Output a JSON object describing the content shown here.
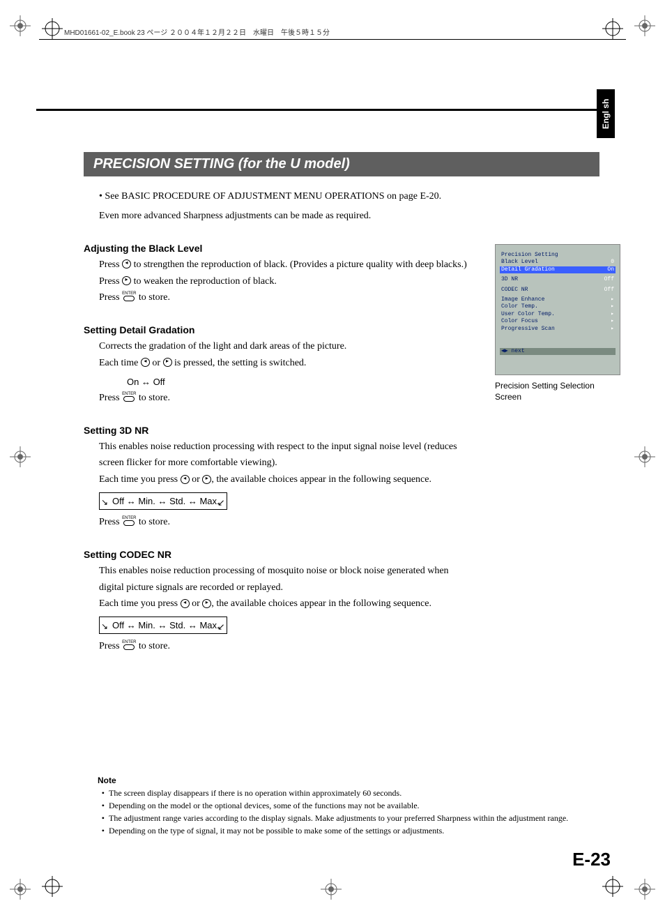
{
  "meta": {
    "header_line": "MHD01661-02_E.book  23 ページ  ２００４年１２月２２日　水曜日　午後５時１５分"
  },
  "lang_tab": "English",
  "title": "PRECISION SETTING (for the U model)",
  "intro": {
    "bullet": "See BASIC PROCEDURE OF ADJUSTMENT MENU OPERATIONS on page E-20.",
    "line": "Even more advanced Sharpness adjustments can be made as required."
  },
  "black_level": {
    "head": "Adjusting the Black Level",
    "l1a": "Press ",
    "l1b": " to strengthen the reproduction of black. (Provides a picture quality with deep blacks.)",
    "l2a": "Press ",
    "l2b": " to weaken the reproduction of black.",
    "l3a": "Press ",
    "l3b": " to store."
  },
  "detail": {
    "head": "Setting Detail Gradation",
    "l1": "Corrects the gradation of the light and dark areas of the picture.",
    "l2a": "Each time ",
    "l2b": " or ",
    "l2c": " is pressed, the setting is switched.",
    "toggle": "On ↔ Off",
    "l3a": "Press ",
    "l3b": " to store."
  },
  "nr3d": {
    "head": "Setting 3D NR",
    "l1": "This enables noise reduction processing with respect to the input signal noise level (reduces screen flicker for more comfortable viewing).",
    "l2a": "Each time you press ",
    "l2b": " or ",
    "l2c": ", the available choices appear in the following sequence.",
    "seq": "Off ↔ Min. ↔ Std. ↔ Max.",
    "l3a": "Press ",
    "l3b": " to store."
  },
  "codec": {
    "head": "Setting CODEC NR",
    "l1": "This enables noise reduction processing of mosquito noise or block noise generated when digital picture signals are recorded or replayed.",
    "l2a": "Each time you press ",
    "l2b": " or ",
    "l2c": ", the available choices appear in the following sequence.",
    "seq": "Off ↔ Min. ↔ Std. ↔ Max.",
    "l3a": "Press ",
    "l3b": " to store."
  },
  "osd": {
    "title": "Precision Setting",
    "r1": "Black Level",
    "r1v": "0",
    "r2": "Detail Gradation",
    "r2v": "On",
    "r3": "3D NR",
    "r3v": "Off",
    "r4": "CODEC NR",
    "r4v": "Off",
    "r5": "Image Enhance",
    "r5v": "▸",
    "r6": "Color Temp.",
    "r6v": "▸",
    "r7": "User Color Temp.",
    "r7v": "▸",
    "r8": "Color Focus",
    "r8v": "▸",
    "r9": "Progressive Scan",
    "r9v": "▸",
    "next": "◀▶ next",
    "caption": "Precision Setting Selection Screen"
  },
  "notes": {
    "head": "Note",
    "items": [
      "The screen display disappears if there is no operation within approximately 60 seconds.",
      "Depending on the model or the optional devices, some of the functions may not be available.",
      "The adjustment range varies according to the display signals. Make adjustments to your preferred Sharpness within the adjustment range.",
      "Depending on the type of signal, it may not be possible to make some of the settings or adjustments."
    ]
  },
  "page_number": "E-23",
  "enter_label": "ENTER"
}
